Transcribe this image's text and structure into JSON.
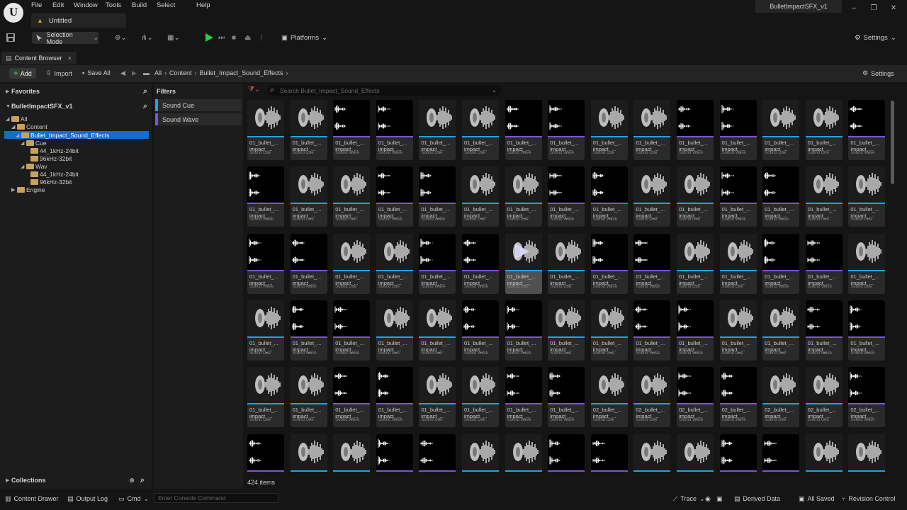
{
  "window": {
    "project_title": "BulletImpactSFX_v1",
    "doc_tab": "Untitled",
    "minimize": "–",
    "restore": "❐",
    "close": "✕"
  },
  "menu": [
    "File",
    "Edit",
    "Window",
    "Tools",
    "Build",
    "Select",
    "Help"
  ],
  "toolbar": {
    "mode": "Selection Mode",
    "platforms": "Platforms",
    "settings": "Settings"
  },
  "content_browser": {
    "tab_label": "Content Browser",
    "tab_close": "×",
    "add": "Add",
    "import": "Import",
    "save_all": "Save All",
    "breadcrumb": [
      "All",
      "Content",
      "Bullet_Impact_Sound_Effects"
    ],
    "settings": "Settings",
    "search_placeholder": "Search Bullet_Impact_Sound_Effects",
    "item_count": "424 items"
  },
  "left_panel": {
    "favorites": "Favorites",
    "project": "BulletImpactSFX_v1",
    "tree": [
      {
        "label": "All",
        "level": 0
      },
      {
        "label": "Content",
        "level": 1
      },
      {
        "label": "Bullet_Impact_Sound_Effects",
        "level": 2,
        "selected": true
      },
      {
        "label": "Cue",
        "level": 3
      },
      {
        "label": "44_1kHz-24bit",
        "level": 4
      },
      {
        "label": "96kHz-32bit",
        "level": 4
      },
      {
        "label": "Wav",
        "level": 3
      },
      {
        "label": "44_1kHz-24bit",
        "level": 4
      },
      {
        "label": "96kHz-32bit",
        "level": 4
      },
      {
        "label": "Engine",
        "level": 1
      }
    ],
    "collections": "Collections"
  },
  "filters": {
    "title": "Filters",
    "items": [
      {
        "label": "Sound Cue",
        "color": "#1fa3e8"
      },
      {
        "label": "Sound Wave",
        "color": "#7a55d6"
      }
    ]
  },
  "colors": {
    "cue": "#1fa3e8",
    "wave": "#7a55d6",
    "selection": "#0f6ed0"
  },
  "asset_labels": {
    "prefix01": "01_bullet_...",
    "prefix02": "02_bullet_...",
    "line2": "impact_...",
    "cue": "Sound Cue",
    "wave": "Sound Wave"
  },
  "grid_rows": [
    "CCWWCCWWCCWWCCW",
    "WCCWWCCWWCCWWCC",
    "WWCCWWCCWWCCWWC",
    "CWWCCWWCCWWCCWW",
    "CCWWCCWWCCWWCCW",
    "WCCWWCCWWCCWWCC"
  ],
  "row5_prefix02_from": 8,
  "hovered_tile": [
    2,
    6
  ],
  "statusbar": {
    "content_drawer": "Content Drawer",
    "output_log": "Output Log",
    "cmd": "Cmd",
    "console_placeholder": "Enter Console Command",
    "trace": "Trace",
    "derived_data": "Derived Data",
    "all_saved": "All Saved",
    "revision_control": "Revision Control"
  }
}
